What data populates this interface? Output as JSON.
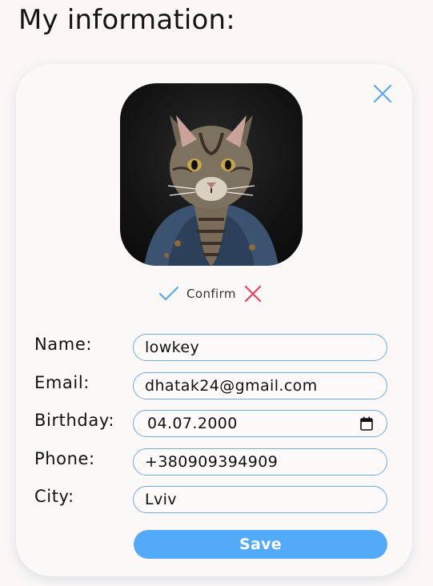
{
  "header": {
    "title": "My information:"
  },
  "avatar": {
    "description_icon": "cat-avatar"
  },
  "confirm": {
    "label": "Confirm"
  },
  "fields": {
    "name": {
      "label": "Name:",
      "value": "lowkey"
    },
    "email": {
      "label": "Email:",
      "value": "dhatak24@gmail.com"
    },
    "birthday": {
      "label": "Birthday:",
      "value": "04.07.2000"
    },
    "phone": {
      "label": "Phone:",
      "value": "+380909394909"
    },
    "city": {
      "label": "City:",
      "value": "Lviv"
    }
  },
  "save": {
    "label": "Save"
  },
  "colors": {
    "accent": "#53aaf8",
    "input_border": "#6aaee8",
    "cancel": "#e2475e",
    "background": "#fcf7f6"
  },
  "icons": {
    "close": "close-icon",
    "confirm": "check-icon",
    "cancel": "x-icon",
    "calendar": "calendar-icon"
  }
}
